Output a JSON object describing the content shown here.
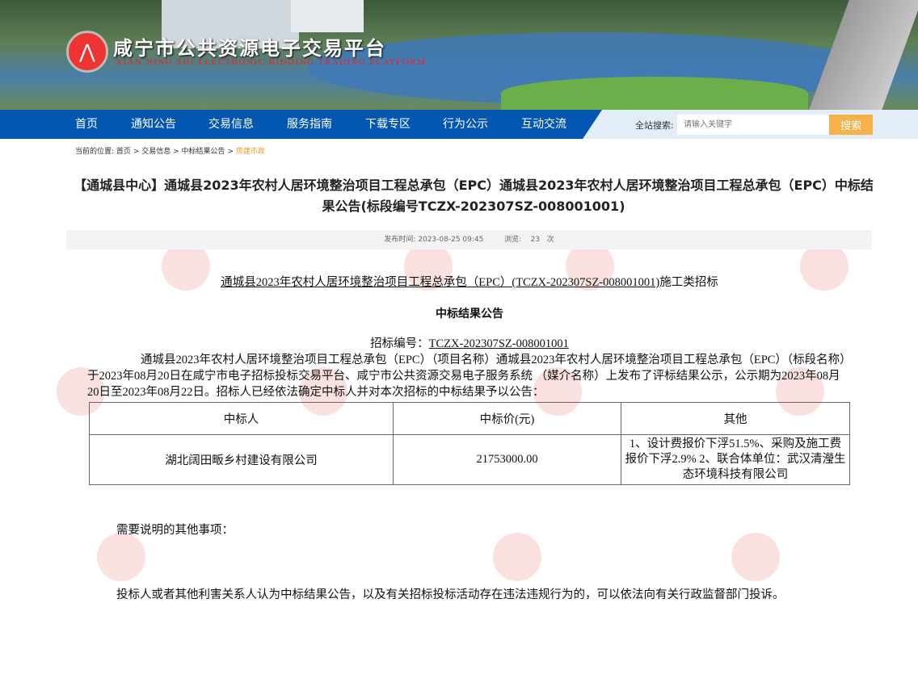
{
  "header": {
    "title": "咸宁市公共资源电子交易平台",
    "subtitle": "XIAN NING SHI ELECTRONIC BIDDING TRADING PLATFORM"
  },
  "nav": {
    "items": [
      "首页",
      "通知公告",
      "交易信息",
      "服务指南",
      "下载专区",
      "行为公示",
      "互动交流"
    ],
    "search_label": "全站搜索:",
    "search_placeholder": "请输入关键字",
    "search_button": "搜索"
  },
  "breadcrumb": {
    "prefix": "当前的位置:",
    "items": [
      "首页",
      "交易信息",
      "中标结果公告"
    ],
    "current": "房建市政",
    "sep": ">"
  },
  "article": {
    "title": "【通城县中心】通城县2023年农村人居环境整治项目工程总承包（EPC）通城县2023年农村人居环境整治项目工程总承包（EPC）中标结果公告(标段编号TCZX-202307SZ-008001001)",
    "publish_label": "发布时间:",
    "publish_time": "2023-08-25 09:45",
    "views_label": "浏览:",
    "views": "23",
    "views_unit": "次",
    "project_line_link": "通城县2023年农村人居环境整治项目工程总承包（EPC）(TCZX-202307SZ-008001001)",
    "project_line_suffix": "施工类招标",
    "heading": "中标结果公告",
    "bid_no_label": "招标编号：",
    "bid_no": "TCZX-202307SZ-008001001",
    "intro": "通城县2023年农村人居环境整治项目工程总承包（EPC）（项目名称）通城县2023年农村人居环境整治项目工程总承包（EPC）（标段名称）于2023年08月20日在咸宁市电子招标投标交易平台、咸宁市公共资源交易电子服务系统 （媒介名称）上发布了评标结果公示，公示期为2023年08月20日至2023年08月22日。招标人已经依法确定中标人并对本次招标的中标结果予以公告：",
    "table": {
      "headers": [
        "中标人",
        "中标价(元)",
        "其他"
      ],
      "rows": [
        [
          "湖北阔田畈乡村建设有限公司",
          "21753000.00",
          "1、设计费报价下浮51.5%、采购及施工费报价下浮2.9% 2、联合体单位：武汉清瀅生态环境科技有限公司"
        ]
      ]
    },
    "notes_label": "需要说明的其他事项：",
    "complaint": "投标人或者其他利害关系人认为中标结果公告，以及有关招标投标活动存在违法违规行为的，可以依法向有关行政监督部门投诉。"
  },
  "colors": {
    "nav_blue": "#0457b0",
    "search_button": "#f5b14b",
    "breadcrumb_current": "#f19a1c"
  }
}
